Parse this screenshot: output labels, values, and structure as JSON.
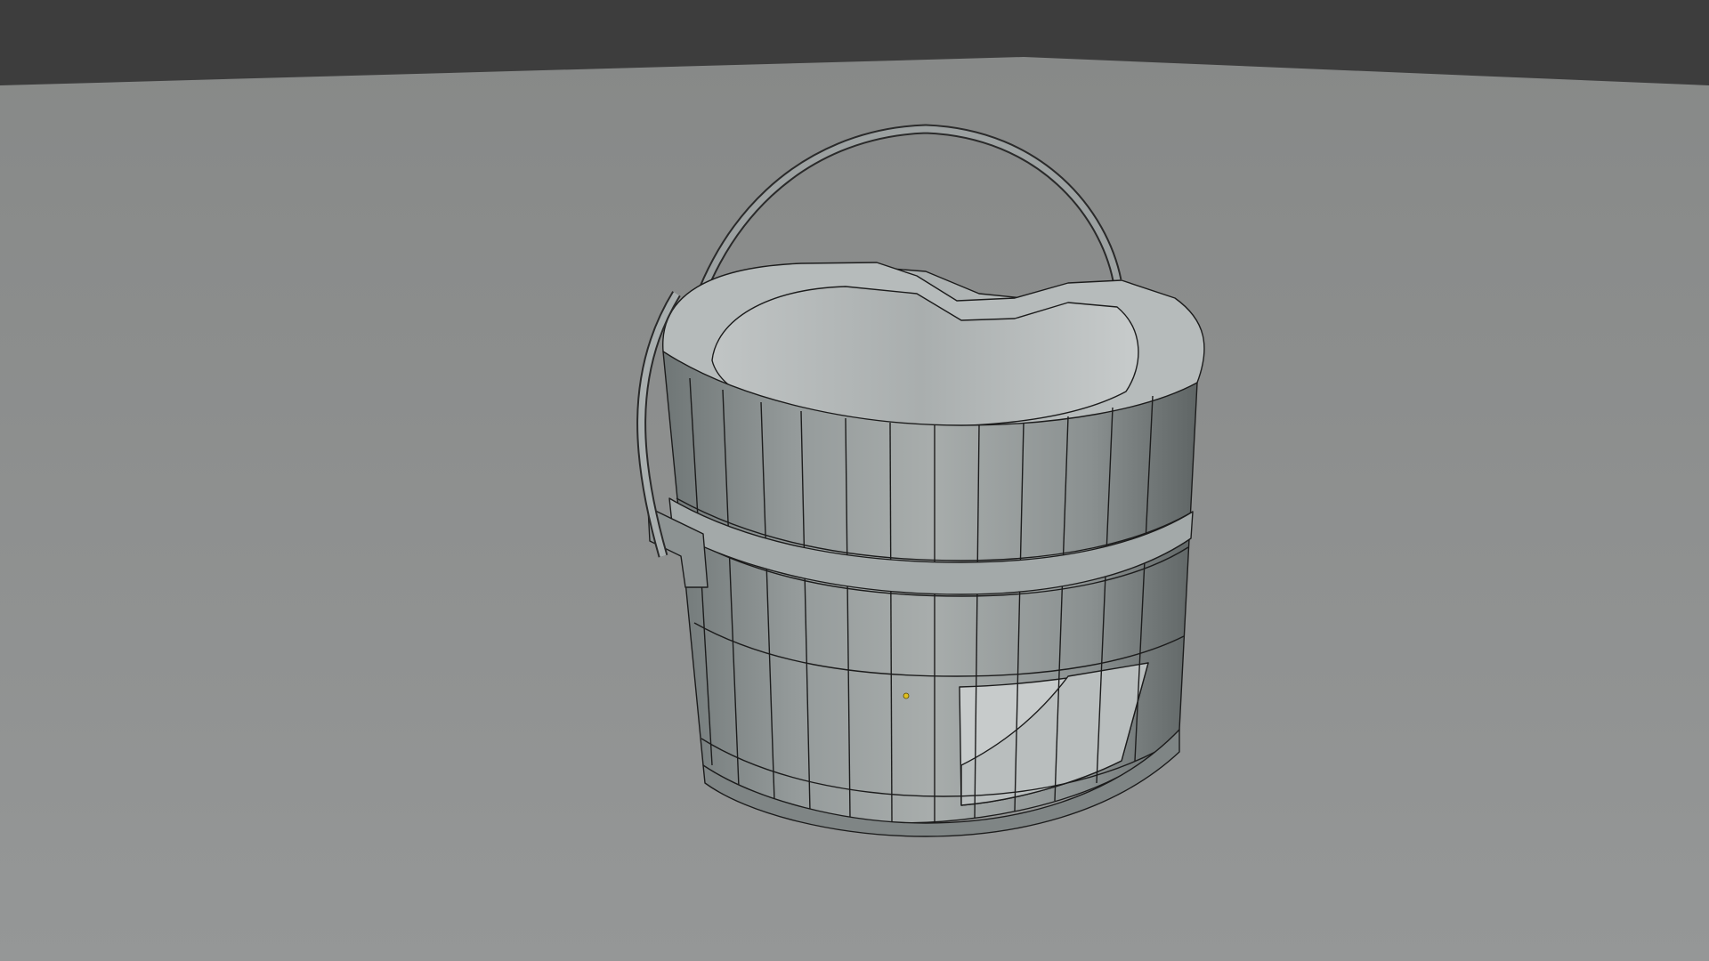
{
  "viewport": {
    "mode": "3d-viewport",
    "shading": "solid-wireframe-overlay",
    "background_color": "#3d3d3d",
    "floor_color": "#8d8f8e",
    "object": "bucket",
    "object_color": "#9aa0a0",
    "wire_color": "#1c1c1c",
    "origin_marker_color": "#e0c020"
  }
}
